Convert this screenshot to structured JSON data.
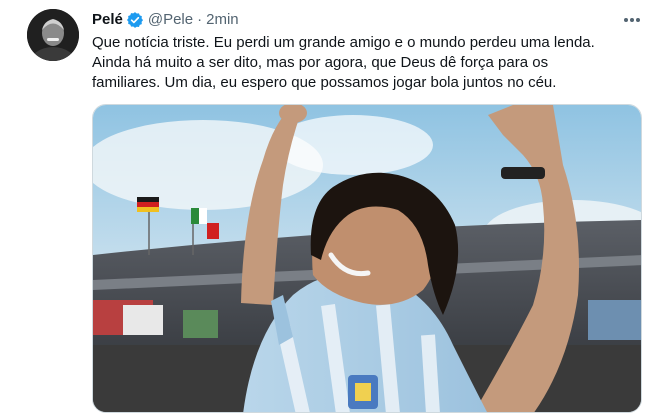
{
  "tweet": {
    "author_name": "Pelé",
    "handle": "@Pele",
    "separator": "·",
    "time": "2min",
    "text_lines": [
      "Que notícia triste. Eu perdi um grande amigo e o mundo perdeu uma lenda.",
      "Ainda há muito a ser dito, mas por agora, que Deus dê força para os",
      "familiares. Um dia, eu espero que possamos jogar bola juntos no céu."
    ],
    "icons": {
      "avatar": "profile-photo",
      "verified": "verified-badge-icon",
      "more": "more-options-icon"
    },
    "colors": {
      "verified": "#1d9bf0",
      "text": "#0f1419",
      "muted": "#536471"
    }
  }
}
